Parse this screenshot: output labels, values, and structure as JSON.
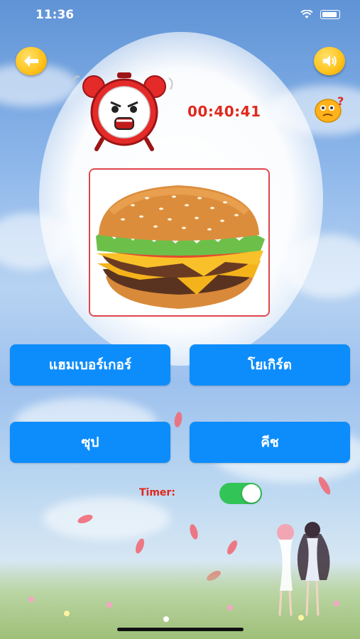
{
  "status_bar": {
    "time": "11:36"
  },
  "timer": {
    "value": "00:40:41",
    "label": "Timer:",
    "enabled": true
  },
  "answers": [
    {
      "label": "แฮมเบอร์เกอร์"
    },
    {
      "label": "โยเกิร์ต"
    },
    {
      "label": "ซุป"
    },
    {
      "label": "คีช"
    }
  ],
  "colors": {
    "accent_blue": "#0d8dfb",
    "timer_red": "#e0281d",
    "toggle_green": "#33c458",
    "icon_yellow": "#ffc21a"
  },
  "icons": {
    "back": "back-arrow-icon",
    "sound": "speaker-icon",
    "hint": "question-emoji-icon",
    "clock": "alarm-clock-icon"
  }
}
